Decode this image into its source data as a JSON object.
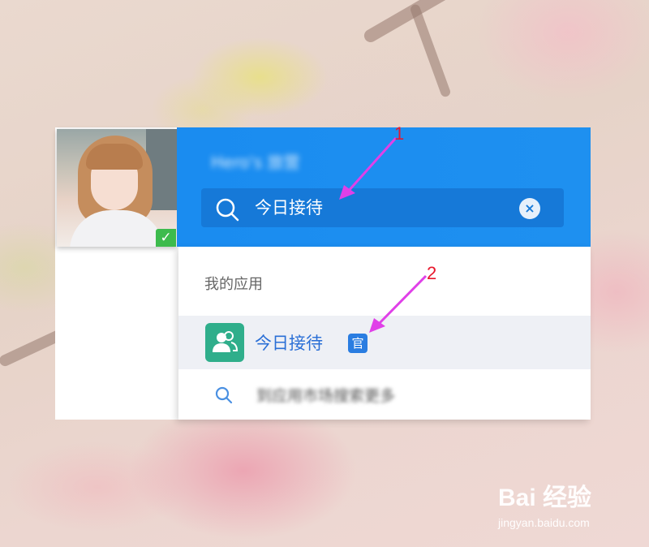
{
  "header": {
    "title_blurred": "Hero's 旅营",
    "search": {
      "query": "今日接待"
    }
  },
  "dropdown": {
    "section_label": "我的应用",
    "result": {
      "name": "今日接待",
      "badge": "官"
    },
    "more_blurred": "到应用市场搜索更多"
  },
  "annotations": [
    "1",
    "2"
  ],
  "watermark": {
    "brand": "Bai 经验",
    "url": "jingyan.baidu.com"
  },
  "colors": {
    "header_blue": "#1e90f0",
    "search_bg": "#1679d8",
    "app_icon_green": "#2fae8b",
    "arrow_magenta": "#e040e8",
    "status_green": "#3dbb4d"
  },
  "icons": [
    "search-icon",
    "clear-icon",
    "contacts-app-icon",
    "official-badge-icon",
    "check-icon"
  ]
}
